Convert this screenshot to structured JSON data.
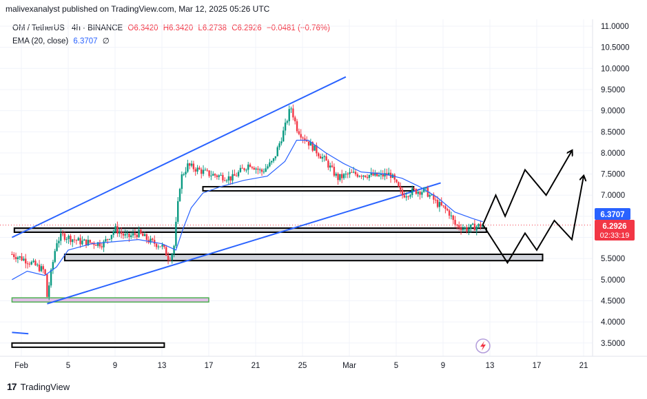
{
  "publish_info": "malivexanalyst published on TradingView.com, Mar 12, 2025 05:26 UTC",
  "legend": {
    "symbol": "OM / TetherUS · 4h · BINANCE",
    "open": "O6.3420",
    "high": "H6.3420",
    "low": "L6.2738",
    "close": "C6.2926",
    "change": "−0.0481 (−0.76%)",
    "ema_label": "EMA (20, close)",
    "ema_value": "6.3707",
    "ema_icon": "∅"
  },
  "price_tags": {
    "ema": "6.3707",
    "last": "6.2926",
    "countdown": "02:33:19"
  },
  "footer": {
    "brand": "TradingView",
    "logo": "17"
  },
  "colors": {
    "up": "#089981",
    "down": "#f23645",
    "ema": "#2962ff",
    "trendline": "#2962ff",
    "zone_fill": "#d1d4dc",
    "support_zone": "#e1bee7"
  },
  "chart_data": {
    "type": "candlestick",
    "title": "",
    "xlabel": "",
    "ylabel": "",
    "ylim": [
      3.25,
      11.2
    ],
    "yticks": [
      "11.0000",
      "10.5000",
      "10.0000",
      "9.5000",
      "9.0000",
      "8.5000",
      "8.0000",
      "7.5000",
      "7.0000",
      "6.5000",
      "6.0000",
      "5.5000",
      "5.0000",
      "4.5000",
      "4.0000",
      "3.5000"
    ],
    "xticks": [
      "Feb",
      "5",
      "9",
      "13",
      "17",
      "21",
      "25",
      "Mar",
      "5",
      "9",
      "13",
      "17",
      "21"
    ],
    "xtick_days": [
      0,
      4,
      8,
      12,
      16,
      20,
      24,
      28,
      32,
      36,
      40,
      44,
      48
    ],
    "price_path": [
      [
        -0.8,
        5.6
      ],
      [
        0.5,
        5.45
      ],
      [
        2.0,
        5.2
      ],
      [
        2.2,
        4.6
      ],
      [
        2.5,
        5.1
      ],
      [
        3.0,
        5.9
      ],
      [
        3.5,
        6.05
      ],
      [
        5,
        5.9
      ],
      [
        7,
        5.85
      ],
      [
        8,
        6.2
      ],
      [
        9,
        6.0
      ],
      [
        10,
        6.1
      ],
      [
        11,
        5.9
      ],
      [
        12,
        5.8
      ],
      [
        12.6,
        5.5
      ],
      [
        13.0,
        5.7
      ],
      [
        13.3,
        6.6
      ],
      [
        13.6,
        7.4
      ],
      [
        14.2,
        7.7
      ],
      [
        16,
        7.5
      ],
      [
        18,
        7.4
      ],
      [
        19.5,
        7.75
      ],
      [
        20.5,
        7.55
      ],
      [
        21.5,
        7.8
      ],
      [
        22.5,
        8.6
      ],
      [
        23.0,
        9.1
      ],
      [
        23.5,
        8.6
      ],
      [
        24,
        8.4
      ],
      [
        25,
        8.1
      ],
      [
        26,
        7.8
      ],
      [
        27,
        7.4
      ],
      [
        28,
        7.5
      ],
      [
        29,
        7.5
      ],
      [
        30.5,
        7.45
      ],
      [
        31.5,
        7.5
      ],
      [
        32.5,
        7.0
      ],
      [
        33.5,
        7.1
      ],
      [
        34.5,
        7.1
      ],
      [
        35.5,
        6.8
      ],
      [
        36.5,
        6.6
      ],
      [
        37,
        6.3
      ],
      [
        38,
        6.2
      ],
      [
        39.4,
        6.3
      ]
    ],
    "ema_path": [
      [
        -0.8,
        5.0
      ],
      [
        0.5,
        5.2
      ],
      [
        2,
        5.1
      ],
      [
        3,
        5.3
      ],
      [
        4,
        5.7
      ],
      [
        6,
        5.85
      ],
      [
        8,
        5.9
      ],
      [
        10,
        5.95
      ],
      [
        12,
        5.85
      ],
      [
        13.2,
        5.7
      ],
      [
        13.8,
        6.2
      ],
      [
        14.5,
        6.7
      ],
      [
        15.5,
        7.05
      ],
      [
        17,
        7.2
      ],
      [
        19,
        7.35
      ],
      [
        21,
        7.45
      ],
      [
        22.5,
        7.8
      ],
      [
        23.5,
        8.3
      ],
      [
        24.5,
        8.3
      ],
      [
        26,
        8.0
      ],
      [
        27.5,
        7.75
      ],
      [
        29,
        7.55
      ],
      [
        31,
        7.5
      ],
      [
        32.5,
        7.4
      ],
      [
        34,
        7.2
      ],
      [
        35.5,
        6.95
      ],
      [
        37,
        6.6
      ],
      [
        38.5,
        6.45
      ],
      [
        39.4,
        6.37
      ]
    ],
    "wedge_upper": [
      [
        -0.8,
        6.0
      ],
      [
        27.7,
        9.8
      ]
    ],
    "wedge_lower": [
      [
        2.2,
        4.43
      ],
      [
        35.8,
        7.29
      ]
    ],
    "ema_stub": [
      [
        -0.8,
        3.75
      ],
      [
        0.6,
        3.72
      ]
    ],
    "zones": [
      {
        "name": "resistance-zone-top",
        "x1": 15.5,
        "x2": 33.5,
        "y1": 7.14,
        "y2": 7.2,
        "fill": "#ffffff"
      },
      {
        "name": "zone-middle",
        "x1": -0.6,
        "x2": 39.7,
        "y1": 6.15,
        "y2": 6.22,
        "fill": "#d1d4dc"
      },
      {
        "name": "support-zone",
        "x1": 3.7,
        "x2": 44.5,
        "y1": 5.45,
        "y2": 5.6,
        "fill": "#d1d4dc"
      },
      {
        "name": "demand-zone-low",
        "x1": -0.8,
        "x2": 16.0,
        "y1": 4.47,
        "y2": 4.57,
        "fill": "#e1bee7"
      },
      {
        "name": "zone-bottom",
        "x1": -0.8,
        "x2": 12.2,
        "y1": 3.4,
        "y2": 3.5,
        "fill": "#ffffff"
      }
    ],
    "projection_upper": [
      [
        39.4,
        6.3
      ],
      [
        40.5,
        7.0
      ],
      [
        41.3,
        6.5
      ],
      [
        43,
        7.6
      ],
      [
        44.8,
        7.0
      ],
      [
        47,
        8.05
      ]
    ],
    "projection_lower": [
      [
        39.4,
        6.3
      ],
      [
        41.5,
        5.4
      ],
      [
        43,
        6.1
      ],
      [
        44,
        5.7
      ],
      [
        45.5,
        6.4
      ],
      [
        47,
        5.95
      ],
      [
        48,
        7.45
      ]
    ]
  }
}
